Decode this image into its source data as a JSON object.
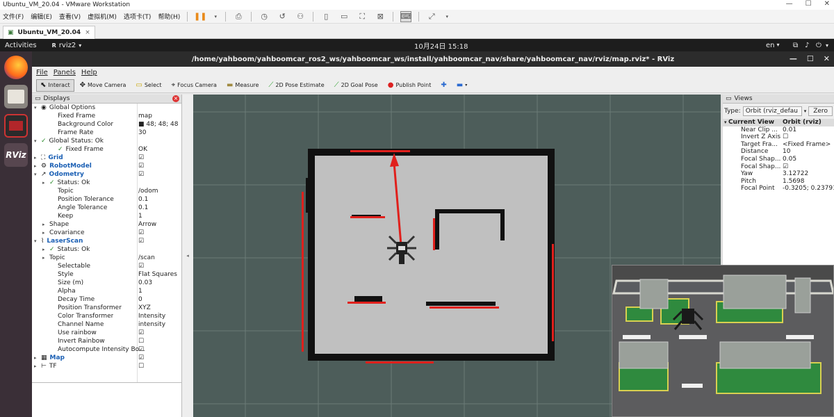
{
  "vmware": {
    "title": "Ubuntu_VM_20.04 - VMware Workstation",
    "menu": [
      "文件(F)",
      "编辑(E)",
      "查看(V)",
      "虚拟机(M)",
      "选项卡(T)",
      "帮助(H)"
    ],
    "tab_label": "Ubuntu_VM_20.04",
    "tab_close": "×"
  },
  "gnome": {
    "activities": "Activities",
    "app_name": "rviz2",
    "clock": "10月24日  15:18",
    "lang": "en"
  },
  "dock": {
    "rviz_label": "RViz"
  },
  "rviz": {
    "window_title": "/home/yahboom/yahboomcar_ros2_ws/yahboomcar_ws/install/yahboomcar_nav/share/yahboomcar_nav/rviz/map.rviz* - RViz",
    "menu": [
      "File",
      "Panels",
      "Help"
    ],
    "tools": [
      "Interact",
      "Move Camera",
      "Select",
      "Focus Camera",
      "Measure",
      "2D Pose Estimate",
      "2D Goal Pose",
      "Publish Point"
    ]
  },
  "displays": {
    "title": "Displays",
    "rows": [
      {
        "arrow": "▾",
        "icon": "◉",
        "label": "Global Options",
        "value": "",
        "indent": 0
      },
      {
        "arrow": "",
        "label": "Fixed Frame",
        "value": "map",
        "indent": 2
      },
      {
        "arrow": "",
        "label": "Background Color",
        "value": "■ 48; 48; 48",
        "indent": 2
      },
      {
        "arrow": "",
        "label": "Frame Rate",
        "value": "30",
        "indent": 2
      },
      {
        "arrow": "▾",
        "icon": "✓",
        "label": "Global Status: Ok",
        "value": "",
        "indent": 0
      },
      {
        "arrow": "",
        "icon": "✓",
        "label": "Fixed Frame",
        "value": "OK",
        "indent": 2
      },
      {
        "arrow": "▸",
        "icon": "⛶",
        "label": "Grid",
        "value": "☑",
        "indent": 0,
        "blue": true
      },
      {
        "arrow": "▸",
        "icon": "⚙",
        "label": "RobotModel",
        "value": "☑",
        "indent": 0,
        "blue": true
      },
      {
        "arrow": "▾",
        "icon": "↗",
        "label": "Odometry",
        "value": "☑",
        "indent": 0,
        "blue": true
      },
      {
        "arrow": "▸",
        "icon": "✓",
        "label": "Status: Ok",
        "value": "",
        "indent": 1
      },
      {
        "arrow": "",
        "label": "Topic",
        "value": "/odom",
        "indent": 2
      },
      {
        "arrow": "",
        "label": "Position Tolerance",
        "value": "0.1",
        "indent": 2
      },
      {
        "arrow": "",
        "label": "Angle Tolerance",
        "value": "0.1",
        "indent": 2
      },
      {
        "arrow": "",
        "label": "Keep",
        "value": "1",
        "indent": 2
      },
      {
        "arrow": "▸",
        "label": "Shape",
        "value": "Arrow",
        "indent": 1
      },
      {
        "arrow": "▸",
        "label": "Covariance",
        "value": "☑",
        "indent": 1
      },
      {
        "arrow": "▾",
        "icon": "⌇",
        "label": "LaserScan",
        "value": "☑",
        "indent": 0,
        "blue": true
      },
      {
        "arrow": "▸",
        "icon": "✓",
        "label": "Status: Ok",
        "value": "",
        "indent": 1
      },
      {
        "arrow": "▸",
        "label": "Topic",
        "value": "/scan",
        "indent": 1
      },
      {
        "arrow": "",
        "label": "Selectable",
        "value": "☑",
        "indent": 2
      },
      {
        "arrow": "",
        "label": "Style",
        "value": "Flat Squares",
        "indent": 2
      },
      {
        "arrow": "",
        "label": "Size (m)",
        "value": "0.03",
        "indent": 2
      },
      {
        "arrow": "",
        "label": "Alpha",
        "value": "1",
        "indent": 2
      },
      {
        "arrow": "",
        "label": "Decay Time",
        "value": "0",
        "indent": 2
      },
      {
        "arrow": "",
        "label": "Position Transformer",
        "value": "XYZ",
        "indent": 2
      },
      {
        "arrow": "",
        "label": "Color Transformer",
        "value": "Intensity",
        "indent": 2
      },
      {
        "arrow": "",
        "label": "Channel Name",
        "value": "intensity",
        "indent": 2
      },
      {
        "arrow": "",
        "label": "Use rainbow",
        "value": "☑",
        "indent": 2
      },
      {
        "arrow": "",
        "label": "Invert Rainbow",
        "value": "☐",
        "indent": 2
      },
      {
        "arrow": "",
        "label": "Autocompute Intensity Bo...",
        "value": "☑",
        "indent": 2
      },
      {
        "arrow": "▸",
        "icon": "▦",
        "label": "Map",
        "value": "☑",
        "indent": 0,
        "blue": true
      },
      {
        "arrow": "▸",
        "icon": "⊢",
        "label": "TF",
        "value": "☐",
        "indent": 0
      }
    ]
  },
  "views": {
    "title": "Views",
    "type_label": "Type:",
    "type_value": "Orbit (rviz_defau",
    "zero_label": "Zero",
    "header_key": "Current View",
    "header_value": "Orbit (rviz)",
    "rows": [
      {
        "label": "Near Clip ...",
        "value": "0.01"
      },
      {
        "label": "Invert Z Axis",
        "value": "☐"
      },
      {
        "label": "Target Fra...",
        "value": "<Fixed Frame>"
      },
      {
        "label": "Distance",
        "value": "10"
      },
      {
        "label": "Focal Shap...",
        "value": "0.05"
      },
      {
        "label": "Focal Shap...",
        "value": "☑"
      },
      {
        "label": "Yaw",
        "value": "3.12722"
      },
      {
        "label": "Pitch",
        "value": "1.5698"
      },
      {
        "label": "Focal Point",
        "value": "-0.3205; 0.23791..."
      }
    ]
  },
  "colors": {
    "viewport_bg": "#303030",
    "map_free": "#bfbfbf",
    "map_wall": "#111111",
    "laser": "#e0201c",
    "dock_bg": "#3a2f37",
    "accent_orange": "#e95420"
  }
}
